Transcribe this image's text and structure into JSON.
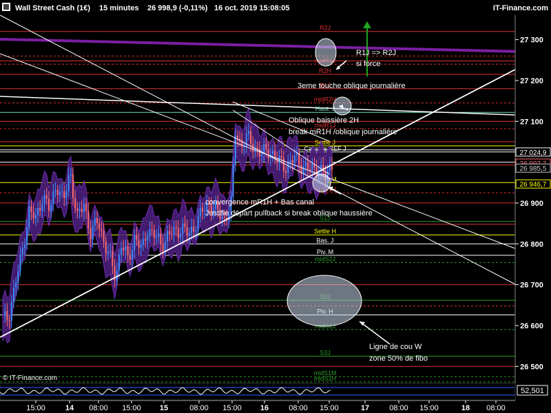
{
  "header": {
    "instrument": "Wall Street Cash (1€)",
    "timeframe": "15 minutes",
    "last": "26 998,9 (-0,11%)",
    "datetime": "16 oct. 2019 15:08:05",
    "brand": "IT-Finance.com"
  },
  "copyright": "© IT-Finance.com",
  "colors": {
    "background": "#000000",
    "candle_up": "#3d8fff",
    "candle_down": "#ff6e6e",
    "band_fill": "#4b1f7a",
    "band_stroke": "#7a32c8",
    "resistance": "#e03030",
    "support": "#2d9c2d",
    "pivot": "#ffffff",
    "settle": "#ffff00",
    "thick_trend": "#7b1fa2"
  },
  "chart_data": {
    "type": "candlestick",
    "title": "",
    "ylim": [
      26470,
      26760
    ],
    "ylim_note": "",
    "y_range": [
      26460,
      27360
    ],
    "y_ticks": [
      "27 300",
      "27 200",
      "27 100",
      "27 000",
      "26 900",
      "26 800",
      "26 700",
      "26 600",
      "26 500"
    ],
    "y_tick_values": [
      27300,
      27200,
      27100,
      27000,
      26900,
      26800,
      26700,
      26600,
      26500
    ],
    "x_ticks": [
      "15:00",
      "14",
      "08:00",
      "15:00",
      "15",
      "08:00",
      "15:00",
      "16",
      "08:00",
      "15:00",
      "17",
      "08:00",
      "15:00",
      "18",
      "08:00"
    ],
    "price_badges": [
      {
        "label": "27 024,9",
        "value": 27024.9,
        "color": "#ffffff"
      },
      {
        "label": "26 997,7",
        "value": 26997.7,
        "color": "#ff6e6e"
      },
      {
        "label": "26 985,5",
        "value": 26985.5,
        "color": "#cccccc"
      },
      {
        "label": "26 946,7",
        "value": 26946.7,
        "color": "#ffff00"
      }
    ],
    "levels": [
      {
        "label": "R2J",
        "value": 27320,
        "color": "#e03030",
        "style": "solid"
      },
      {
        "label": "",
        "value": 27260,
        "color": "#e03030",
        "style": "dashed"
      },
      {
        "label": "",
        "value": 27248,
        "color": "#e03030",
        "style": "solid"
      },
      {
        "label": "midR1J",
        "value": 27240,
        "color": "#e03030",
        "style": "dashed"
      },
      {
        "label": "R2H",
        "value": 27215,
        "color": "#e03030",
        "style": "solid"
      },
      {
        "label": "R1J",
        "value": 27180,
        "color": "#e03030",
        "style": "solid"
      },
      {
        "label": "midR2H",
        "value": 27145,
        "color": "#e03030",
        "style": "dashed"
      },
      {
        "label": "Haut. J",
        "value": 27122,
        "color": "#6fe0c0",
        "style": "solid"
      },
      {
        "label": "",
        "value": 27100,
        "color": "#e03030",
        "style": "solid"
      },
      {
        "label": "midR1J",
        "value": 27082,
        "color": "#e03030",
        "style": "dashed"
      },
      {
        "label": "",
        "value": 27050,
        "color": "#e03030",
        "style": "solid"
      },
      {
        "label": "Settle J",
        "value": 27040,
        "color": "#ffff00",
        "style": "solid"
      },
      {
        "label": "",
        "value": 27030,
        "color": "#ffffff",
        "style": "solid"
      },
      {
        "label": "Cassure REF J",
        "value": 27025,
        "color": "#ffffff",
        "style": "solid"
      },
      {
        "label": "Piv. J",
        "value": 27000,
        "color": "#ffffff",
        "style": "solid"
      },
      {
        "label": "",
        "value": 26993,
        "color": "#e03030",
        "style": "solid"
      },
      {
        "label": "Settle M",
        "value": 26950,
        "color": "#ffff00",
        "style": "solid"
      },
      {
        "label": "midS1H",
        "value": 26925,
        "color": "#e03030",
        "style": "dashed"
      },
      {
        "label": "",
        "value": 26900,
        "color": "#e03030",
        "style": "solid"
      },
      {
        "label": "S1J",
        "value": 26855,
        "color": "#2d9c2d",
        "style": "solid"
      },
      {
        "label": "",
        "value": 26848,
        "color": "#e03030",
        "style": "solid"
      },
      {
        "label": "Settle H",
        "value": 26822,
        "color": "#ffff00",
        "style": "solid"
      },
      {
        "label": "Bas. J",
        "value": 26800,
        "color": "#ffffff",
        "style": "solid"
      },
      {
        "label": "Piv. M",
        "value": 26772,
        "color": "#ffffff",
        "style": "solid"
      },
      {
        "label": "midS2J",
        "value": 26754,
        "color": "#2d9c2d",
        "style": "dashed"
      },
      {
        "label": "",
        "value": 26700,
        "color": "#e03030",
        "style": "solid"
      },
      {
        "label": "S2J",
        "value": 26662,
        "color": "#2d9c2d",
        "style": "solid"
      },
      {
        "label": "",
        "value": 26648,
        "color": "#e03030",
        "style": "dashed"
      },
      {
        "label": "Piv. H",
        "value": 26626,
        "color": "#ffffff",
        "style": "solid"
      },
      {
        "label": "midS2J",
        "value": 26590,
        "color": "#2d9c2d",
        "style": "dashed"
      },
      {
        "label": "S3J",
        "value": 26525,
        "color": "#2d9c2d",
        "style": "solid"
      },
      {
        "label": "",
        "value": 26500,
        "color": "#e03030",
        "style": "solid"
      },
      {
        "label": "midS1M",
        "value": 26475,
        "color": "#2d9c2d",
        "style": "dashed"
      },
      {
        "label": "midS1H",
        "value": 26462,
        "color": "#2d9c2d",
        "style": "dashed"
      }
    ],
    "indicator": {
      "value_label": "52,501"
    }
  },
  "annotations": {
    "r1j_target": "R1J => R2J",
    "si_force": "si force",
    "third_touch": "3eme touche oblique journalière",
    "oblique_baissiere": "Oblique baissière 2H",
    "break_r1h": "break mR1H /oblique journalière",
    "convergence": "convergence mR1H + Bas canal",
    "justifie": "Justifie départ pullback si break oblique haussière",
    "ligne_de_cou": "Ligne de cou W",
    "zone_fibo": "zone 50% de fibo"
  }
}
